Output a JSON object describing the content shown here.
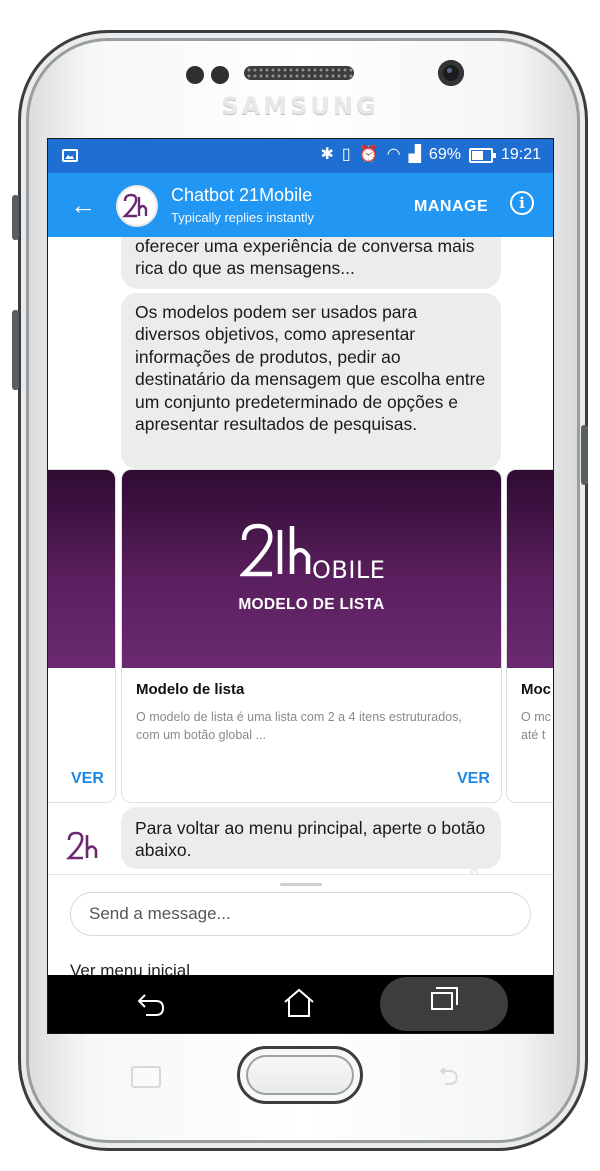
{
  "device": {
    "brand": "SAMSUNG"
  },
  "status_bar": {
    "battery": "69%",
    "time": "19:21"
  },
  "app_bar": {
    "title": "Chatbot 21Mobile",
    "subtitle": "Typically replies instantly",
    "manage_label": "MANAGE"
  },
  "messages": {
    "m1": "oferecer uma experiência de conversa mais rica do que as mensagens...",
    "m2": "Os modelos podem ser usados para diversos objetivos, como apresentar informações de produtos, pedir ao destinatário da mensagem que escolha entre um conjunto predeterminado de opções e apresentar resultados de pesquisas.",
    "m3": "Para voltar ao menu principal, aperte o botão abaixo."
  },
  "carousel": {
    "main_card": {
      "image_logo": "21MOBILE",
      "image_logo_suffix": "OBILE",
      "image_caption": "MODELO DE LISTA",
      "title": "Modelo de lista",
      "description": "O modelo de lista é uma lista com 2 a 4 itens estruturados, com um botão global ...",
      "button": "VER"
    },
    "left_card": {
      "button": "VER"
    },
    "right_card": {
      "title_partial": "Moc",
      "desc_line1": "O mc",
      "desc_line2": "até t"
    }
  },
  "composer": {
    "placeholder": "Send a message...",
    "quick_reply": "Ver menu inicial"
  },
  "colors": {
    "status_bar": "#1e6fd1",
    "app_bar": "#2196f3",
    "bubble": "#ececec",
    "card_button": "#1e88e5",
    "card_image": "#5a1f5e"
  }
}
